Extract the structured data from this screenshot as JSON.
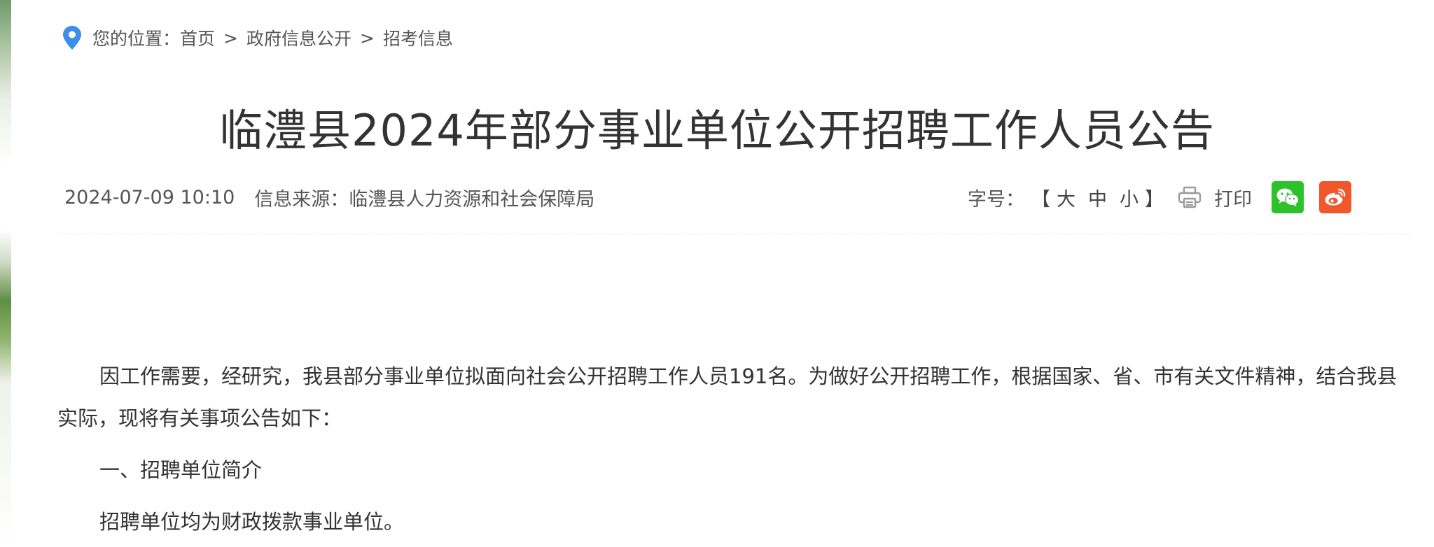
{
  "breadcrumb": {
    "prefix": "您的位置：",
    "items": [
      "首页",
      "政府信息公开",
      "招考信息"
    ],
    "separator": ">"
  },
  "article": {
    "title": "临澧县2024年部分事业单位公开招聘工作人员公告",
    "date": "2024-07-09 10:10",
    "source": "信息来源：临澧县人力资源和社会保障局",
    "paragraphs": [
      "因工作需要，经研究，我县部分事业单位拟面向社会公开招聘工作人员191名。为做好公开招聘工作，根据国家、省、市有关文件精神，结合我县实际，现将有关事项公告如下：",
      "一、招聘单位简介",
      "招聘单位均为财政拨款事业单位。"
    ]
  },
  "tools": {
    "font_size_label": "字号：",
    "bracket_open": "【",
    "bracket_close": "】",
    "sizes": [
      "大",
      "中",
      "小"
    ],
    "print": "打印",
    "share_wechat_icon": "wechat-icon",
    "share_weibo_icon": "weibo-icon"
  },
  "colors": {
    "location_icon": "#3d8ee8",
    "wechat": "#2dc22a",
    "weibo": "#f0582c"
  }
}
